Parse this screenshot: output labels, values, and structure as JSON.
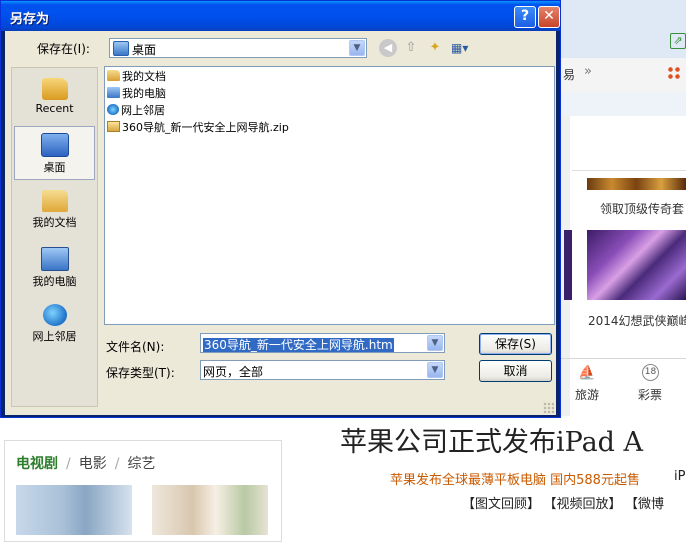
{
  "background": {
    "tab_fragment": "易",
    "tab_arrows": "»",
    "go_icon": "⇗",
    "promo1": "领取顶级传奇套",
    "promo2": "2014幻想武侠巅峰",
    "nav_travel": "旅游",
    "nav_lottery": "彩票",
    "nav_lottery_icon_text": "18",
    "tabs": [
      "电视剧",
      "电影",
      "综艺"
    ],
    "tab_separator": "/",
    "headline": "苹果公司正式发布iPad A",
    "subline": "苹果发布全球最薄平板电脑 国内588元起售",
    "subline2": "iP",
    "links": [
      "【图文回顾】",
      "【视频回放】",
      "【微博"
    ]
  },
  "dialog": {
    "title": "另存为",
    "help_label": "?",
    "close_label": "✕",
    "save_in_label": "保存在(I):",
    "save_in_value": "桌面",
    "places": [
      {
        "label": "Recent",
        "icon": "recent-icon"
      },
      {
        "label": "桌面",
        "icon": "desktop-icon",
        "selected": true
      },
      {
        "label": "我的文档",
        "icon": "my-documents-icon"
      },
      {
        "label": "我的电脑",
        "icon": "my-computer-icon"
      },
      {
        "label": "网上邻居",
        "icon": "network-places-icon"
      }
    ],
    "files": [
      {
        "name": "我的文档",
        "icon": "my-documents-icon"
      },
      {
        "name": "我的电脑",
        "icon": "my-computer-icon"
      },
      {
        "name": "网上邻居",
        "icon": "network-places-icon"
      },
      {
        "name": "360导航_新一代安全上网导航.zip",
        "icon": "zip-folder-icon"
      }
    ],
    "filename_label": "文件名(N):",
    "filename_value": "360导航_新一代安全上网导航.htm",
    "filetype_label": "保存类型(T):",
    "filetype_value": "网页，全部",
    "save_button": "保存(S)",
    "cancel_button": "取消"
  }
}
